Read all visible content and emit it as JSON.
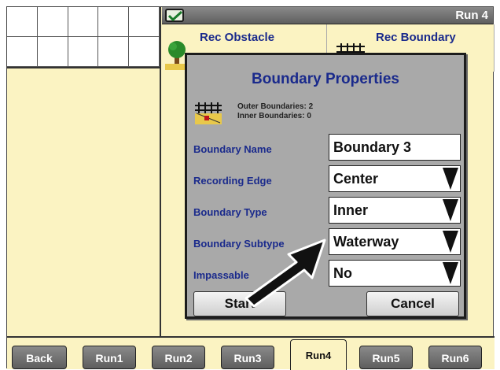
{
  "header": {
    "run_title": "Run 4"
  },
  "background_cards": [
    {
      "label": "Rec Obstacle"
    },
    {
      "label": "Rec Boundary"
    }
  ],
  "dialog": {
    "title": "Boundary Properties",
    "outer_boundaries": "Outer Boundaries: 2",
    "inner_boundaries": "Inner Boundaries: 0",
    "fields": [
      {
        "label": "Boundary Name",
        "value": "Boundary 3",
        "type": "text"
      },
      {
        "label": "Recording Edge",
        "value": "Center",
        "type": "dropdown"
      },
      {
        "label": "Boundary Type",
        "value": "Inner",
        "type": "dropdown"
      },
      {
        "label": "Boundary Subtype",
        "value": "Waterway",
        "type": "dropdown"
      },
      {
        "label": "Impassable",
        "value": "No",
        "type": "dropdown"
      }
    ],
    "start_label": "Start",
    "cancel_label": "Cancel"
  },
  "tabs": [
    {
      "label": "Back"
    },
    {
      "label": "Run1"
    },
    {
      "label": "Run2"
    },
    {
      "label": "Run3"
    },
    {
      "label": "Run4",
      "active": true
    },
    {
      "label": "Run5"
    },
    {
      "label": "Run6"
    }
  ],
  "colors": {
    "accent": "#1a2a8c",
    "panel": "#fbf3c2",
    "dialog": "#a9a9a9"
  }
}
